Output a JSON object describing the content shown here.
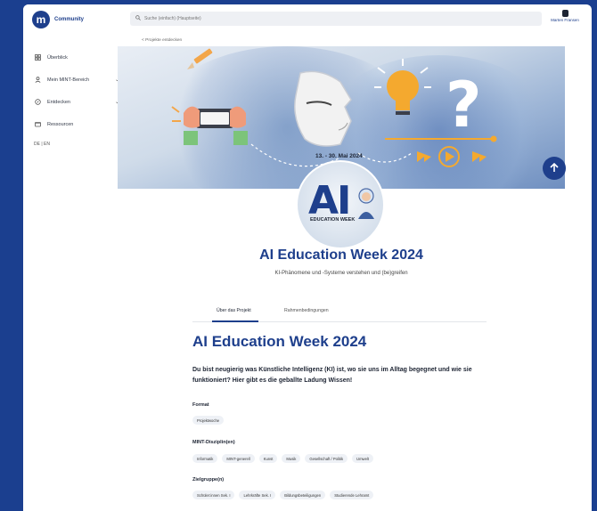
{
  "app": {
    "logo_letter": "m",
    "logo_name": "Community"
  },
  "sidebar": {
    "items": [
      {
        "label": "Überblick",
        "has_chevron": false
      },
      {
        "label": "Mein MINT-Bereich",
        "has_chevron": true
      },
      {
        "label": "Entdecken",
        "has_chevron": true
      },
      {
        "label": "Ressourcen",
        "has_chevron": false
      }
    ],
    "language": "DE | EN",
    "chevron": "⌄"
  },
  "search": {
    "placeholder": "Suche (einfach) (Hauptseite)"
  },
  "user": {
    "name": "Marten Fransen"
  },
  "back_link": "< Projekte entdecken",
  "hero": {
    "date_badge": "13. - 30. Mai 2024",
    "emblem_text": "AI",
    "emblem_sub": "EDUCATION WEEK"
  },
  "project": {
    "title": "AI Education Week 2024",
    "subtitle": "KI-Phänomene und -Systeme verstehen und (be)greifen"
  },
  "tabs": [
    {
      "label": "Über das Projekt",
      "active": true
    },
    {
      "label": "Rahmenbedingungen",
      "active": false
    }
  ],
  "content": {
    "heading": "AI Education Week 2024",
    "intro": "Du bist neugierig was Künstliche Intelligenz (KI) ist, wo sie uns im Alltag begegnet und wie sie funktioniert? Hier gibt es die geballte Ladung Wissen!",
    "sections": [
      {
        "label": "Format",
        "chips": [
          "Projektwoche"
        ]
      },
      {
        "label": "MINT-Disziplin(en)",
        "chips": [
          "Informatik",
          "MINT-generell",
          "Kunst",
          "Musik",
          "Gesellschaft / Politik",
          "Umwelt"
        ]
      },
      {
        "label": "Zielgruppe(n)",
        "chips": [
          "Schüler:innen Sek. I",
          "Lehrkräfte Sek. I",
          "Bildungsbeteiligungen",
          "Studierende Lehramt"
        ]
      }
    ]
  },
  "icons": {
    "search": "search-icon",
    "up": "arrow-up-icon"
  },
  "colors": {
    "brand": "#1e3f8c",
    "background": "#1b3f8f"
  }
}
